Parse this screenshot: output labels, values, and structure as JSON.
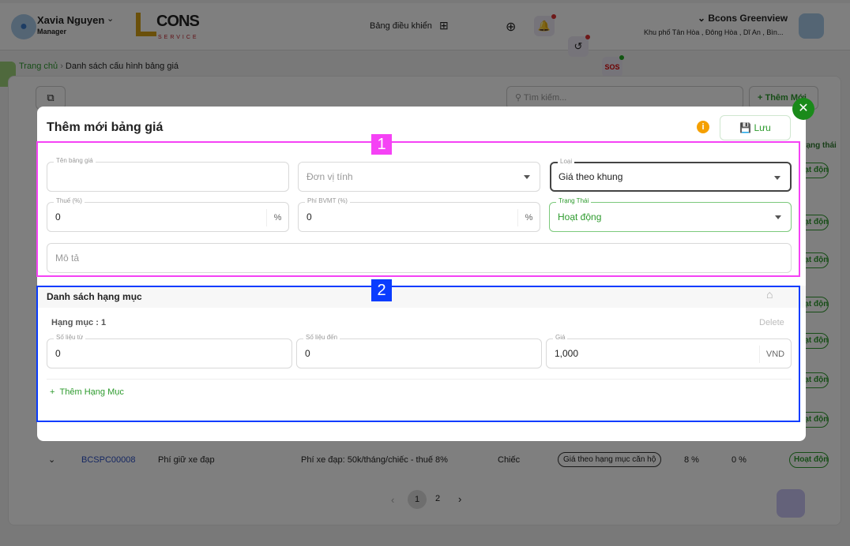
{
  "header": {
    "user_name": "Xavia Nguyen",
    "user_role": "Manager",
    "logo_text": "CONS",
    "logo_sub": "SERVICE",
    "dashboard_label": "Bảng điều khiển",
    "sos_label": "SOS",
    "project_name": "Bcons Greenview",
    "project_address": "Khu phố Tân Hòa , Đông Hòa , Dĩ An , Bìn..."
  },
  "breadcrumb": {
    "home": "Trang chủ",
    "current": "Danh sách cấu hình bảng giá"
  },
  "toolbar": {
    "search_placeholder": "Tìm kiếm...",
    "add_label": "Thêm Mới"
  },
  "table": {
    "status_header": "Trạng thái",
    "status_badge": "Hoạt động",
    "last_row": {
      "code": "BCSPC00008",
      "name": "Phí giữ xe đạp",
      "description": "Phí xe đạp: 50k/tháng/chiếc - thuế 8%",
      "unit": "Chiếc",
      "type": "Giá theo hạng mục căn hộ",
      "tax": "8 %",
      "env_fee": "0 %",
      "status": "Hoạt động"
    }
  },
  "pagination": {
    "pages": [
      "1",
      "2"
    ],
    "current": "1"
  },
  "modal": {
    "title": "Thêm mới bảng giá",
    "save_label": "Lưu",
    "form": {
      "name": {
        "label": "Tên bảng giá",
        "value": ""
      },
      "unit": {
        "placeholder": "Đơn vị tính"
      },
      "type": {
        "label": "Loại",
        "value": "Giá theo khung"
      },
      "tax": {
        "label": "Thuế (%)",
        "value": "0",
        "suffix": "%"
      },
      "env_fee": {
        "label": "Phí BVMT (%)",
        "value": "0",
        "suffix": "%"
      },
      "status": {
        "label": "Trạng Thái",
        "value": "Hoạt động"
      },
      "description": {
        "placeholder": "Mô tả"
      }
    },
    "items_section": {
      "title": "Danh sách hạng mục",
      "item_title": "Hạng mục : 1",
      "delete_label": "Delete",
      "from": {
        "label": "Số liệu từ",
        "value": "0"
      },
      "to": {
        "label": "Số liệu đến",
        "value": "0"
      },
      "price": {
        "label": "Giá",
        "value": "1,000",
        "suffix": "VND"
      },
      "add_label": "Thêm Hạng Mục"
    }
  },
  "annotations": {
    "box1": "1",
    "box2": "2",
    "box1_color": "#f542f5",
    "box2_color": "#0a3cff"
  },
  "colors": {
    "accent": "#2e9b2e",
    "close": "#1a8a1a",
    "info": "#f5a000"
  }
}
